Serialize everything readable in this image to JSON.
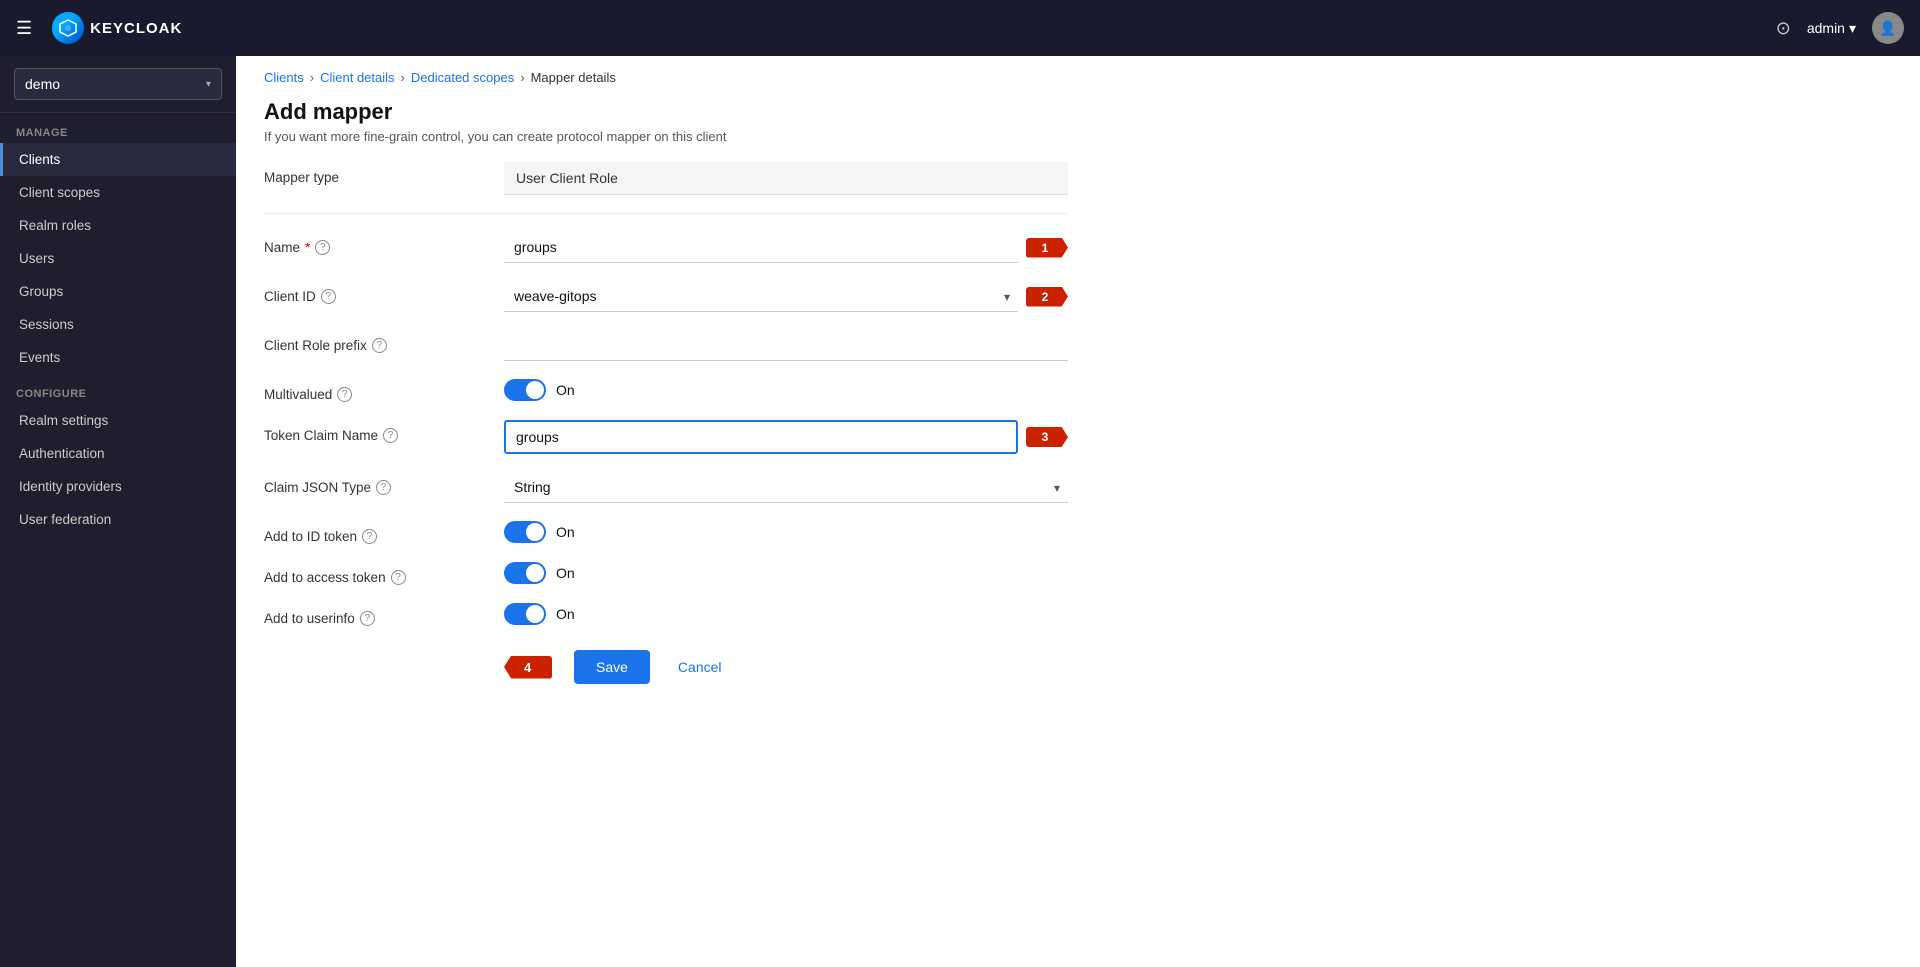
{
  "topbar": {
    "logo_text": "KEYCLOAK",
    "user_label": "admin",
    "chevron": "▾"
  },
  "sidebar": {
    "realm": "demo",
    "manage_label": "Manage",
    "configure_label": "Configure",
    "items_manage": [
      {
        "id": "clients",
        "label": "Clients",
        "active": true
      },
      {
        "id": "client-scopes",
        "label": "Client scopes",
        "active": false
      },
      {
        "id": "realm-roles",
        "label": "Realm roles",
        "active": false
      },
      {
        "id": "users",
        "label": "Users",
        "active": false
      },
      {
        "id": "groups",
        "label": "Groups",
        "active": false
      },
      {
        "id": "sessions",
        "label": "Sessions",
        "active": false
      },
      {
        "id": "events",
        "label": "Events",
        "active": false
      }
    ],
    "items_configure": [
      {
        "id": "realm-settings",
        "label": "Realm settings",
        "active": false
      },
      {
        "id": "authentication",
        "label": "Authentication",
        "active": false
      },
      {
        "id": "identity-providers",
        "label": "Identity providers",
        "active": false
      },
      {
        "id": "user-federation",
        "label": "User federation",
        "active": false
      }
    ]
  },
  "breadcrumb": {
    "items": [
      {
        "label": "Clients",
        "href": true
      },
      {
        "label": "Client details",
        "href": true
      },
      {
        "label": "Dedicated scopes",
        "href": true
      },
      {
        "label": "Mapper details",
        "href": false
      }
    ]
  },
  "page": {
    "title": "Add mapper",
    "subtitle": "If you want more fine-grain control, you can create protocol mapper on this client"
  },
  "form": {
    "mapper_type_label": "Mapper type",
    "mapper_type_value": "User Client Role",
    "name_label": "Name",
    "name_value": "groups",
    "name_required": "*",
    "client_id_label": "Client ID",
    "client_id_value": "weave-gitops",
    "client_role_prefix_label": "Client Role prefix",
    "client_role_prefix_value": "",
    "multivalued_label": "Multivalued",
    "multivalued_value": "On",
    "token_claim_name_label": "Token Claim Name",
    "token_claim_name_value": "groups",
    "claim_json_type_label": "Claim JSON Type",
    "claim_json_type_value": "String",
    "add_to_id_token_label": "Add to ID token",
    "add_to_id_token_value": "On",
    "add_to_access_token_label": "Add to access token",
    "add_to_access_token_value": "On",
    "add_to_userinfo_label": "Add to userinfo",
    "add_to_userinfo_value": "On",
    "save_label": "Save",
    "cancel_label": "Cancel"
  },
  "annotations": {
    "step1": "1",
    "step2": "2",
    "step3": "3",
    "step4": "4"
  }
}
